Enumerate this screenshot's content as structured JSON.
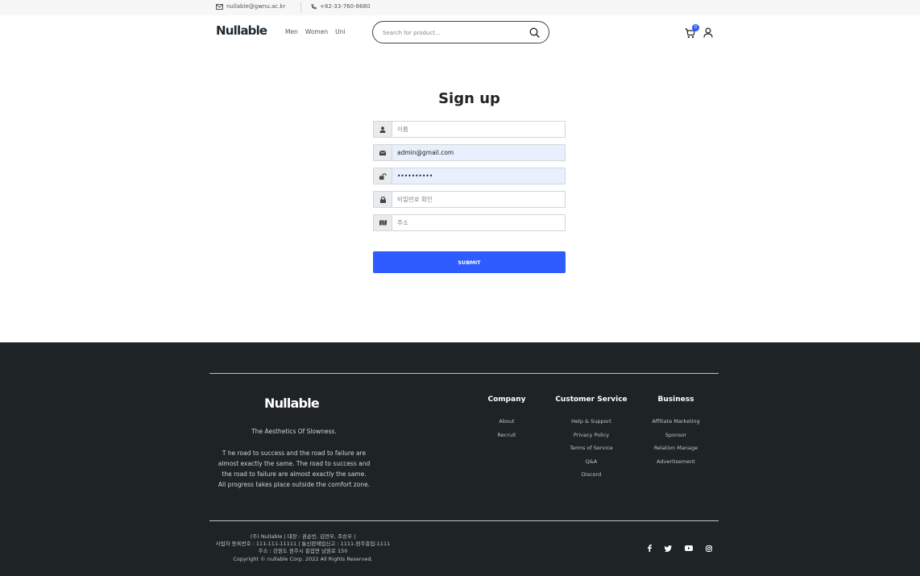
{
  "topbar": {
    "email": "nullable@gwnu.ac.kr",
    "phone": "+82-33-760-8680"
  },
  "header": {
    "logo": "Nullable",
    "nav": [
      "Men",
      "Women",
      "Uni"
    ],
    "search_placeholder": "Search for product...",
    "cart_count": "0"
  },
  "form": {
    "title": "Sign up",
    "name_placeholder": "이름",
    "email_value": "admin@gmail.com",
    "password_value": "••••••••••",
    "confirm_placeholder": "비밀번호 확인",
    "address_placeholder": "주소",
    "submit_label": "SUBMIT"
  },
  "footer": {
    "logo": "Nullable",
    "tagline": "The Aesthetics Of Slowness.",
    "description": "T he road to success and the road to failure are almost exactly the same. The road to success and the road to failure are almost exactly the same. All progress takes place outside the comfort zone.",
    "columns": [
      {
        "heading": "Company",
        "links": [
          "About",
          "Recruit"
        ]
      },
      {
        "heading": "Customer Service",
        "links": [
          "Help & Support",
          "Privacy Policy",
          "Terms of Service",
          "Q&A",
          "Discord"
        ]
      },
      {
        "heading": "Business",
        "links": [
          "Affiliate Marketing",
          "Sponsor",
          "Relation Manage",
          "Advertisement"
        ]
      }
    ],
    "corp_lines": [
      "(주) Nullable | 대장 : 권순빈, 김연우, 조승우 |",
      "사업자 등록번호 : 111-111-11111 | 통신판매업신고 : 1111-원주흥업-1111",
      "주소 : 강원도 원주시 흥업면 남원로 150",
      "Copyright © nullable Corp. 2022 All Rights Reserved."
    ],
    "social_icons": [
      "facebook-icon",
      "twitter-icon",
      "youtube-icon",
      "instagram-icon"
    ]
  }
}
